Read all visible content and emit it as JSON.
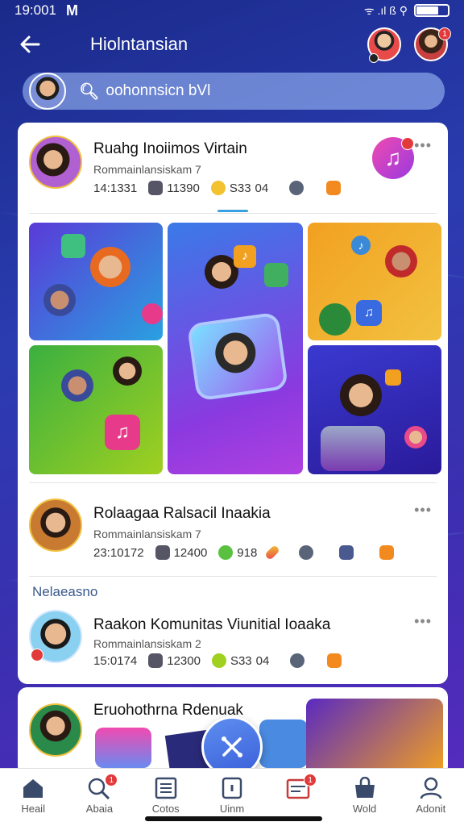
{
  "status": {
    "time": "19:001",
    "mail_icon": "mail-icon",
    "indicators": "ᯤ .ıl ß ⚲"
  },
  "header": {
    "title": "Hiolntansian"
  },
  "search": {
    "placeholder": "oohonnsicn bVl"
  },
  "feed": [
    {
      "name": "Ruahg Inoiimos Virtain",
      "sub": "Rommainlansiskam 7",
      "stats": [
        "14:1331",
        "11390",
        "S33",
        "04"
      ]
    },
    {
      "name": "Rolaagaa Ralsacil Inaakia",
      "sub": "Rommainlansiskam 7",
      "stats": [
        "23:10172",
        "12400",
        "918"
      ]
    },
    {
      "name": "Raakon Komunitas Viunitial Ioaaka",
      "sub": "Rommainlansiskam 2",
      "stats": [
        "15:0174",
        "12300",
        "S33",
        "04"
      ]
    },
    {
      "name": "Eruohothrna Rdenuak"
    }
  ],
  "section_label": "Nelaeasno",
  "nav": [
    {
      "label": "Heail",
      "icon": "home-icon"
    },
    {
      "label": "Abaia",
      "icon": "search-icon",
      "badge": "1"
    },
    {
      "label": "Cotos",
      "icon": "list-icon"
    },
    {
      "label": "Uinm",
      "icon": "add-icon"
    },
    {
      "label": "",
      "icon": "inbox-icon",
      "badge": "1"
    },
    {
      "label": "Wold",
      "icon": "shop-icon"
    },
    {
      "label": "Adonit",
      "icon": "profile-icon"
    }
  ],
  "colors": {
    "accent": "#3b5fd8",
    "badge": "#e23a3a",
    "gradient_top": "#1a2a8a",
    "gradient_bottom": "#5a2ac0"
  }
}
